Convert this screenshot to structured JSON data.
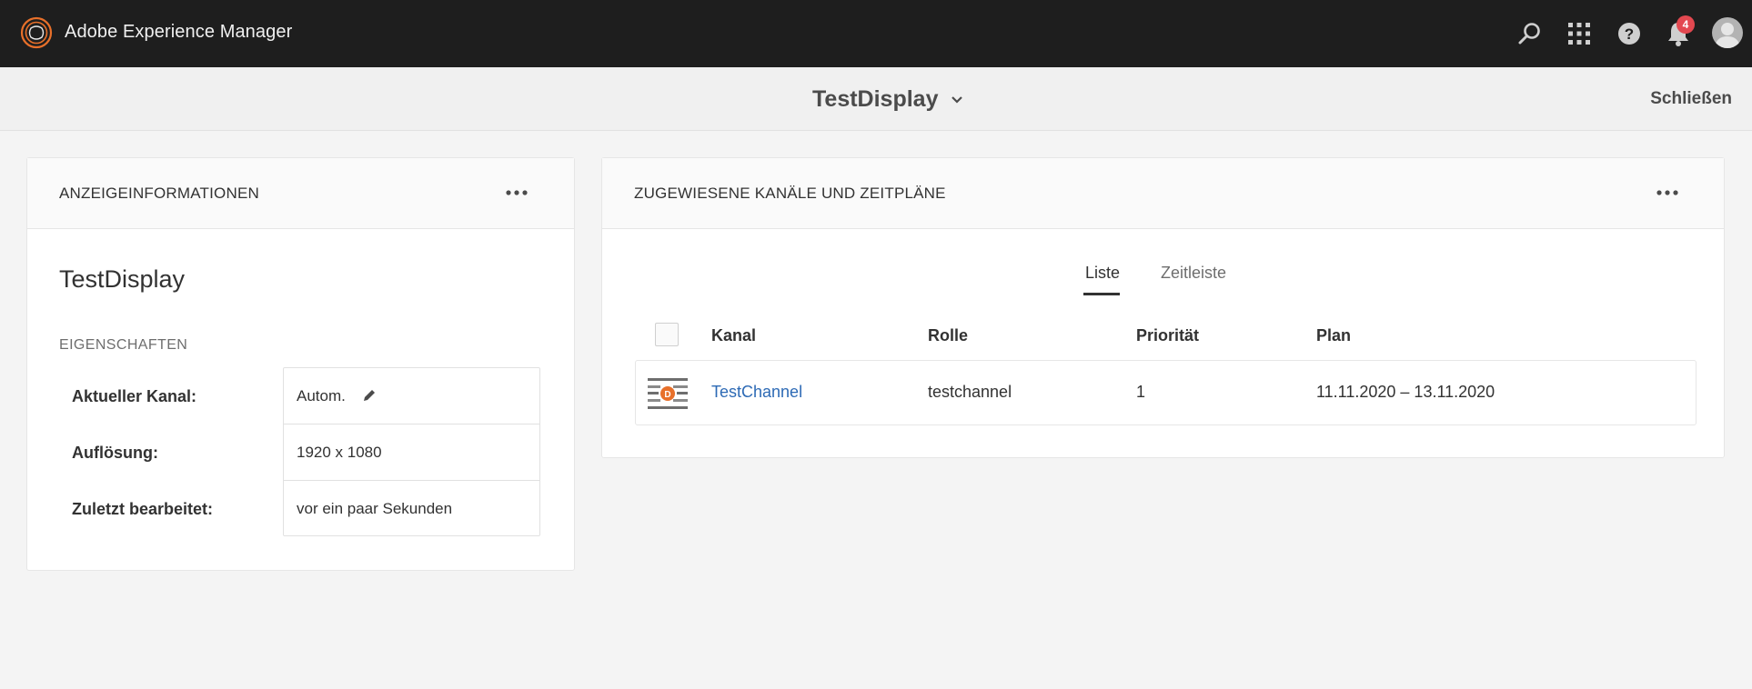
{
  "shell": {
    "app_title": "Adobe Experience Manager",
    "icons": [
      "search-icon",
      "solutions-grid-icon",
      "help-icon",
      "bell-icon",
      "avatar"
    ],
    "notification_count": "4"
  },
  "titlebar": {
    "title": "TestDisplay",
    "close_label": "Schließen"
  },
  "info_card": {
    "heading": "ANZEIGEINFORMATIONEN",
    "display_name": "TestDisplay",
    "properties_heading": "EIGENSCHAFTEN",
    "properties": [
      {
        "label": "Aktueller Kanal:",
        "value": "Autom."
      },
      {
        "label": "Auflösung:",
        "value": "1920 x 1080"
      },
      {
        "label": "Zuletzt bearbeitet:",
        "value": "vor ein paar Sekunden"
      }
    ]
  },
  "channels_card": {
    "heading": "ZUGEWIESENE KANÄLE UND ZEITPLÄNE",
    "tabs": [
      {
        "label": "Liste",
        "active": true
      },
      {
        "label": "Zeitleiste",
        "active": false
      }
    ],
    "columns": [
      "Kanal",
      "Rolle",
      "Priorität",
      "Plan"
    ],
    "rows": [
      {
        "kanal": "TestChannel",
        "rolle": "testchannel",
        "prioritaet": "1",
        "plan": "11.11.2020 – 13.11.2020"
      }
    ]
  },
  "colors": {
    "shell_bg": "#1e1e1e",
    "page_bg": "#f4f4f4",
    "link": "#2d6ab5",
    "brand_orange": "#e8702a",
    "badge_red": "#e34850"
  }
}
